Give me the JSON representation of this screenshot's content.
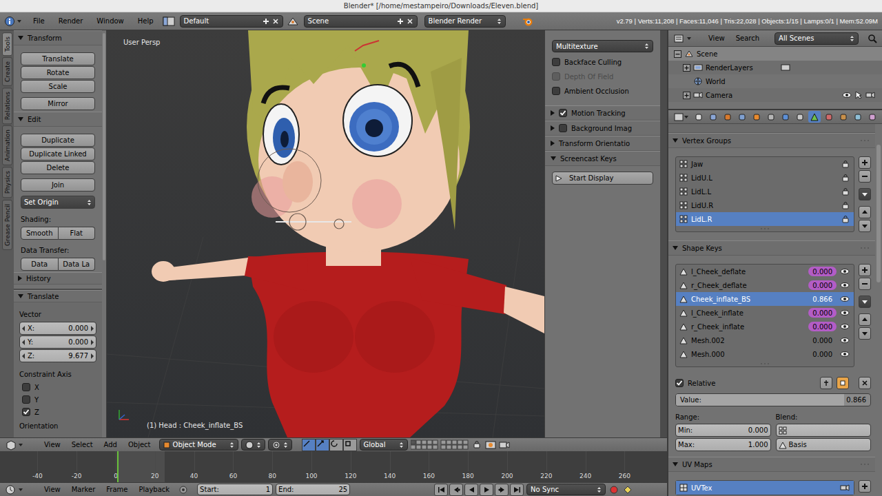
{
  "window": {
    "title": "Blender* [/home/mestampeiro/Downloads/Eleven.blend]"
  },
  "info_header": {
    "menus": [
      "File",
      "Render",
      "Window",
      "Help"
    ],
    "layout": "Default",
    "scene": "Scene",
    "engine": "Blender Render",
    "stats": "v2.79 | Verts:11,208 | Faces:11,046 | Tris:22,028 | Objects:1/15 | Lamps:0/1 | Mem:52.09M"
  },
  "tool_tabs": [
    {
      "label": "Tools",
      "selected": true
    },
    {
      "label": "Create",
      "selected": false
    },
    {
      "label": "Relations",
      "selected": false
    },
    {
      "label": "Animation",
      "selected": false
    },
    {
      "label": "Physics",
      "selected": false
    },
    {
      "label": "Grease Pencil",
      "selected": false
    }
  ],
  "tool_shelf": {
    "panels": [
      {
        "title": "Transform",
        "expanded": true,
        "groups": [
          [
            {
              "kind": "button",
              "label": "Translate"
            },
            {
              "kind": "button",
              "label": "Rotate"
            },
            {
              "kind": "button",
              "label": "Scale"
            }
          ],
          [
            {
              "kind": "button",
              "label": "Mirror"
            }
          ]
        ]
      },
      {
        "title": "Edit",
        "expanded": true,
        "groups": [
          [
            {
              "kind": "button",
              "label": "Duplicate"
            },
            {
              "kind": "button",
              "label": "Duplicate Linked"
            },
            {
              "kind": "button",
              "label": "Delete"
            }
          ],
          [
            {
              "kind": "button",
              "label": "Join"
            }
          ],
          [
            {
              "kind": "dropdown",
              "label": "Set Origin"
            }
          ],
          [
            {
              "kind": "label",
              "label": "Shading:"
            },
            {
              "kind": "pair",
              "labels": [
                "Smooth",
                "Flat"
              ]
            }
          ],
          [
            {
              "kind": "label",
              "label": "Data Transfer:"
            },
            {
              "kind": "pair",
              "labels": [
                "Data",
                "Data La"
              ]
            }
          ]
        ]
      },
      {
        "title": "History",
        "expanded": false,
        "groups": []
      }
    ]
  },
  "operator_panel": {
    "title": "Translate",
    "expanded": true,
    "vector_label": "Vector",
    "vector": [
      {
        "axis": "X:",
        "value": "0.000"
      },
      {
        "axis": "Y:",
        "value": "0.000"
      },
      {
        "axis": "Z:",
        "value": "9.677"
      }
    ],
    "constraint_label": "Constraint Axis",
    "constraints": [
      {
        "label": "X",
        "checked": false
      },
      {
        "label": "Y",
        "checked": false
      },
      {
        "label": "Z",
        "checked": true
      }
    ],
    "orientation_label": "Orientation"
  },
  "viewport": {
    "view_name": "User Persp",
    "object_info": "(1) Head : Cheek_inflate_BS"
  },
  "properties_region": {
    "shading": "Multitexture",
    "options": [
      {
        "label": "Backface Culling",
        "checked": false,
        "disabled": false
      },
      {
        "label": "Depth Of Field",
        "checked": false,
        "disabled": true
      },
      {
        "label": "Ambient Occlusion",
        "checked": false,
        "disabled": false
      }
    ],
    "panels": [
      {
        "title": "Motion Tracking",
        "expanded": false,
        "has_checkbox": true,
        "checked": true
      },
      {
        "title": "Background Imag",
        "expanded": false,
        "has_checkbox": true,
        "checked": false
      },
      {
        "title": "Transform Orientatio",
        "expanded": false,
        "has_checkbox": false,
        "checked": false
      },
      {
        "title": "Screencast Keys",
        "expanded": true,
        "has_checkbox": false,
        "checked": false
      }
    ],
    "button": "Start Display"
  },
  "view3d_header": {
    "menus": [
      "View",
      "Select",
      "Add",
      "Object"
    ],
    "mode": "Object Mode",
    "orientation": "Global"
  },
  "timeline": {
    "ticks": [
      "-40",
      "-20",
      "0",
      "20",
      "40",
      "60",
      "80",
      "100",
      "120",
      "140",
      "160",
      "180",
      "200",
      "220",
      "240",
      "260"
    ],
    "current_frame": 1
  },
  "timeline_header": {
    "menus": [
      "View",
      "Marker",
      "Frame",
      "Playback"
    ],
    "start_label": "Start:",
    "start": "1",
    "end_label": "End:",
    "end": "25",
    "sync": "No Sync"
  },
  "outliner": {
    "menus": [
      "View",
      "Search"
    ],
    "filter": "All Scenes",
    "tree": [
      {
        "label": "Scene",
        "depth": 0,
        "has_children": true,
        "expanded": true,
        "selected": true
      },
      {
        "label": "RenderLayers",
        "depth": 1,
        "has_children": true,
        "expanded": false,
        "selected": false
      },
      {
        "label": "World",
        "depth": 1,
        "has_children": false,
        "expanded": false,
        "selected": false
      },
      {
        "label": "Camera",
        "depth": 1,
        "has_children": true,
        "expanded": false,
        "selected": false
      }
    ]
  },
  "properties": {
    "context_tabs": [
      {
        "selected": false
      },
      {
        "selected": false
      },
      {
        "selected": false
      },
      {
        "selected": false
      },
      {
        "selected": false
      },
      {
        "selected": false
      },
      {
        "selected": false
      },
      {
        "selected": false
      },
      {
        "selected": true
      },
      {
        "selected": false
      },
      {
        "selected": false
      },
      {
        "selected": false
      },
      {
        "selected": false
      }
    ],
    "vertex_groups": {
      "title": "Vertex Groups",
      "expanded": true,
      "items": [
        {
          "name": "Jaw",
          "selected": false
        },
        {
          "name": "LidU.L",
          "selected": false
        },
        {
          "name": "LidL.L",
          "selected": false
        },
        {
          "name": "LidU.R",
          "selected": false
        },
        {
          "name": "LidL.R",
          "selected": true
        }
      ]
    },
    "shape_keys": {
      "title": "Shape Keys",
      "expanded": true,
      "items": [
        {
          "name": "l_Cheek_deflate",
          "value": "0.000",
          "driven": true,
          "selected": false
        },
        {
          "name": "r_Cheek_deflate",
          "value": "0.000",
          "driven": true,
          "selected": false
        },
        {
          "name": "Cheek_inflate_BS",
          "value": "0.866",
          "driven": false,
          "selected": true
        },
        {
          "name": "l_Cheek_inflate",
          "value": "0.000",
          "driven": true,
          "selected": false
        },
        {
          "name": "r_Cheek_inflate",
          "value": "0.000",
          "driven": true,
          "selected": false
        },
        {
          "name": "Mesh.002",
          "value": "0.000",
          "driven": false,
          "selected": false
        },
        {
          "name": "Mesh.000",
          "value": "0.000",
          "driven": false,
          "selected": false
        }
      ],
      "relative_label": "Relative",
      "relative": true,
      "value_label": "Value:",
      "value": "0.866",
      "value_level": 0.866,
      "range_label": "Range:",
      "min_label": "Min:",
      "min": "0.000",
      "max_label": "Max:",
      "max": "1.000",
      "blend_label": "Blend:",
      "relative_key": "Basis"
    },
    "uv_maps": {
      "title": "UV Maps",
      "expanded": true,
      "items": [
        {
          "name": "UVTex",
          "selected": true
        }
      ]
    }
  }
}
